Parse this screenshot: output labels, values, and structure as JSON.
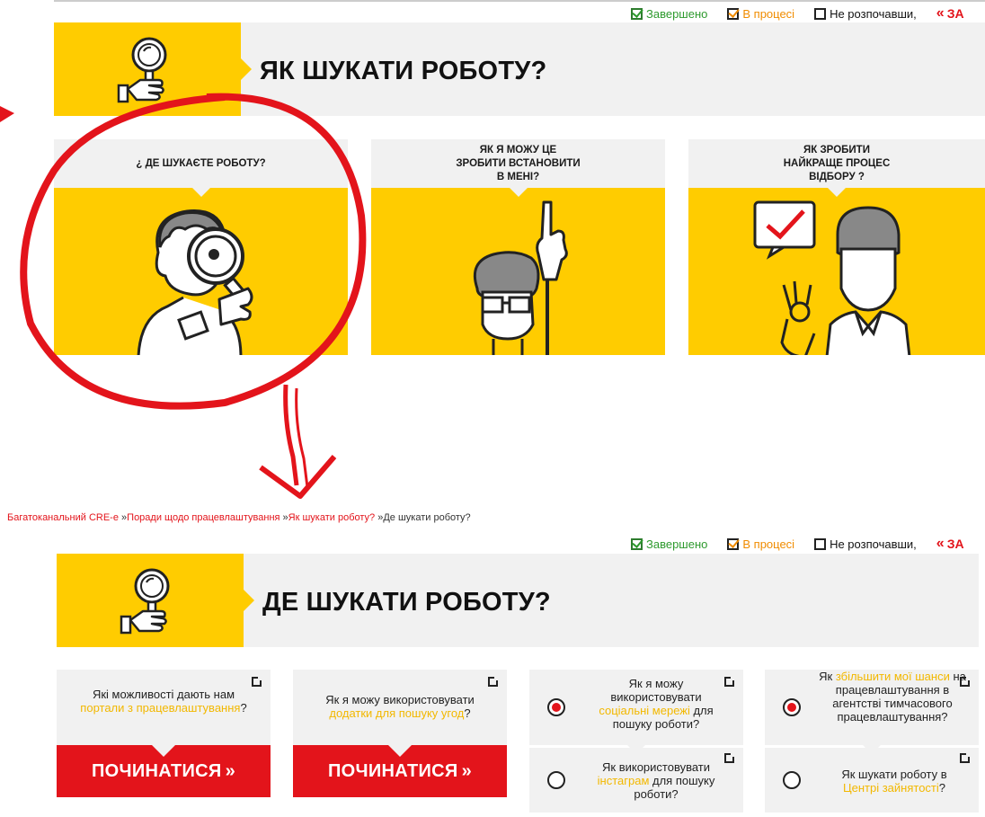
{
  "status_bar": {
    "done": "Завершено",
    "in_progress": "В процесі",
    "not_started": "Не розпочавши,",
    "back": "ЗА"
  },
  "top_header": {
    "title": "ЯК ШУКАТИ РОБОТУ?"
  },
  "top_cards": [
    {
      "caption": "¿ ДЕ ШУКАЄТЕ РОБОТУ?"
    },
    {
      "caption_lines": [
        "ЯК Я МОЖУ ЦЕ",
        "ЗРОБИТИ ВСТАНОВИТИ",
        "В МЕНІ?"
      ]
    },
    {
      "caption_lines": [
        "ЯК ЗРОБИТИ",
        "НАЙКРАЩЕ ПРОЦЕС",
        "ВІДБОРУ ?"
      ]
    }
  ],
  "breadcrumb": {
    "items": [
      "Багатоканальний CRE-e",
      "Поради щодо працевлаштування",
      "Як шукати роботу?",
      "Де шукати роботу?"
    ],
    "separator": "»"
  },
  "bottom_header": {
    "title": "ДЕ ШУКАТИ РОБОТУ?"
  },
  "bottom_cards": {
    "card1": {
      "before": "Які можливості дають нам ",
      "link": "портали з працевлаштування",
      "after": "?",
      "button": "ПОЧИНАТИСЯ"
    },
    "card2": {
      "before": "Як я можу використовувати ",
      "link": "додатки для пошуку угод",
      "after": "?",
      "button": "ПОЧИНАТИСЯ"
    },
    "card3a": {
      "before": "Як я можу використовувати ",
      "link": "соціальні мережі",
      "after": " для пошуку роботи?",
      "selected": true
    },
    "card3b": {
      "before": "Як використовувати ",
      "link": "інстаграм",
      "after": " для пошуку роботи?",
      "selected": false
    },
    "card4a": {
      "before": "Як ",
      "link": "збільшити мої шанси",
      "after": " на працевлаштування в агентстві тимчасового працевлаштування?",
      "selected": true
    },
    "card4b": {
      "before": "Як шукати роботу в ",
      "link": "Центрі зайнятості",
      "after": "?",
      "selected": false
    }
  },
  "colors": {
    "yellow": "#ffcc00",
    "red": "#e3141b",
    "grey": "#f1f1f1",
    "green": "#2e9a2e",
    "orange": "#f08c00"
  }
}
